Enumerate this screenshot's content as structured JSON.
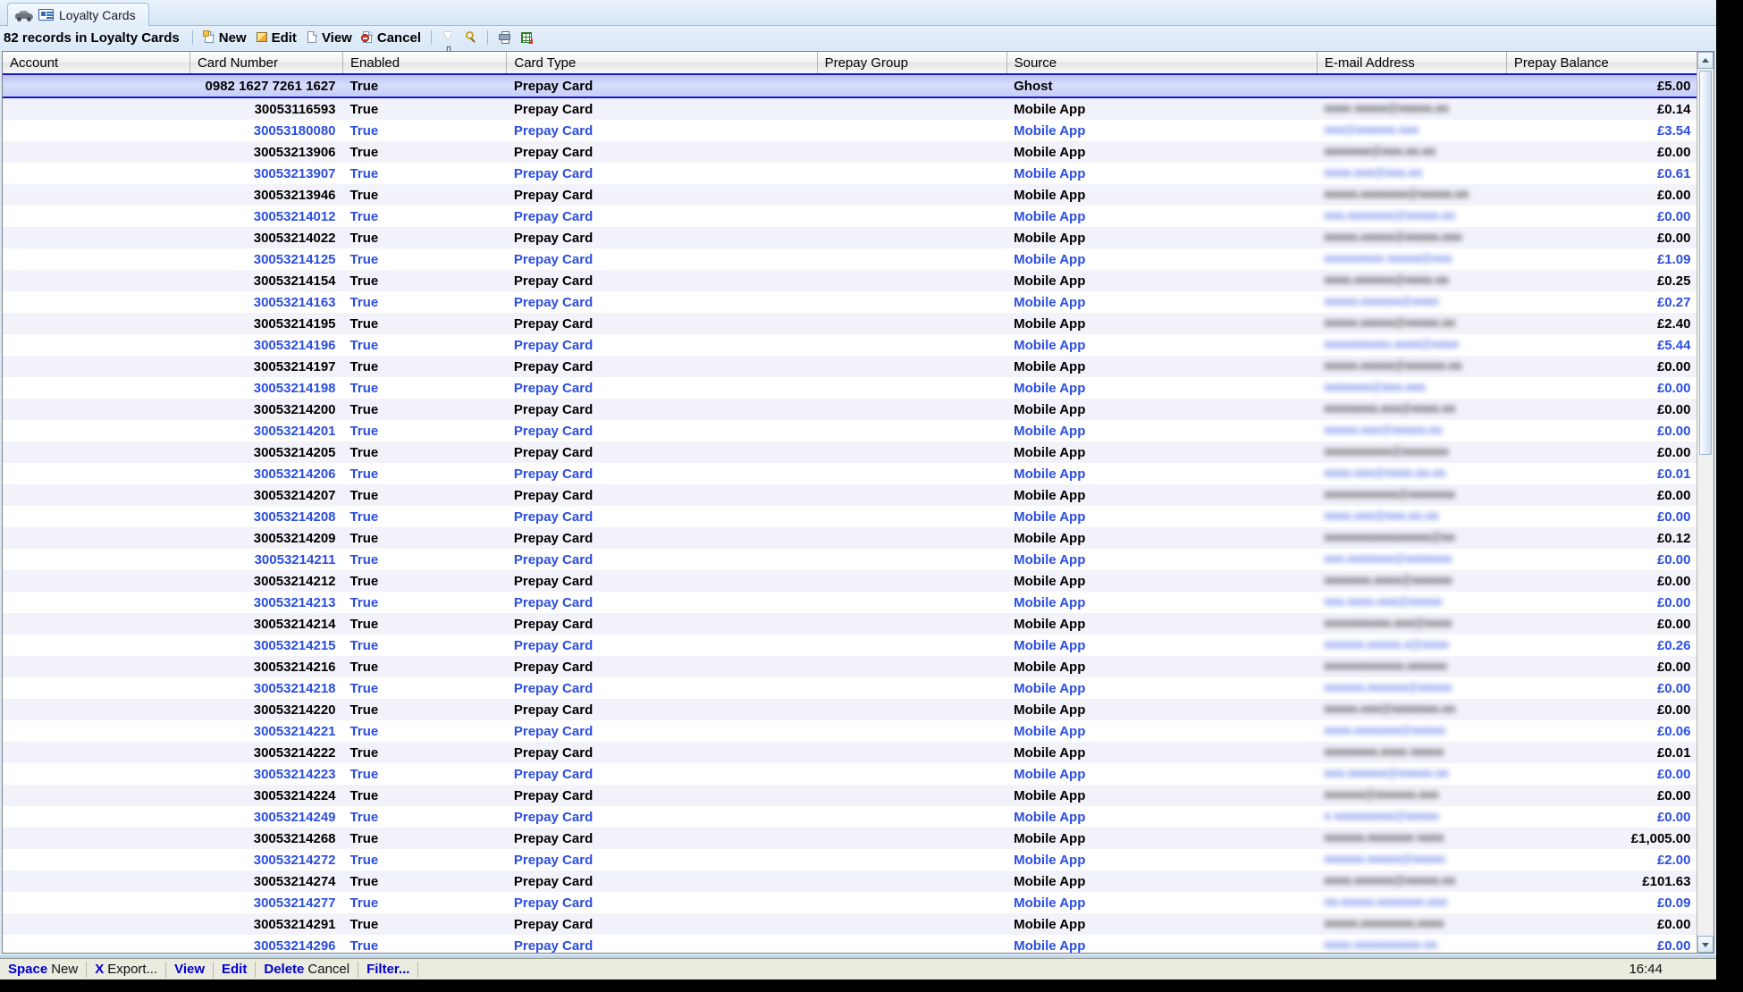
{
  "window": {
    "tab": {
      "title": "Loyalty Cards",
      "car_icon": "car-icon",
      "card_icon": "card-icon"
    }
  },
  "toolbar": {
    "record_count": "82 records in Loyalty Cards",
    "new_label": "New",
    "edit_label": "Edit",
    "view_label": "View",
    "cancel_label": "Cancel",
    "icons": [
      "new-page-icon",
      "pencil-icon",
      "page-icon",
      "cancel-icon",
      "filter-funnel-icon",
      "magnifier-icon",
      "printer-icon",
      "export-grid-icon"
    ]
  },
  "grid": {
    "columns": [
      "Account",
      "Card Number",
      "Enabled",
      "Card Type",
      "Prepay Group",
      "Source",
      "E-mail Address",
      "Prepay Balance"
    ],
    "rows": [
      {
        "account": "",
        "number": "0982 1627 7261 1627",
        "enabled": "True",
        "type": "Prepay Card",
        "group": "",
        "source": "Ghost",
        "email": "",
        "balance": "£5.00",
        "selected": true
      },
      {
        "account": "",
        "number": "30053116593",
        "enabled": "True",
        "type": "Prepay Card",
        "group": "",
        "source": "Mobile App",
        "email": "aaaa aaaaa@aaaaa.aa",
        "balance": "£0.14"
      },
      {
        "account": "",
        "number": "30053180080",
        "enabled": "True",
        "type": "Prepay Card",
        "group": "",
        "source": "Mobile App",
        "email": "aaa@aaaaaa.aaa",
        "balance": "£3.54"
      },
      {
        "account": "",
        "number": "30053213906",
        "enabled": "True",
        "type": "Prepay Card",
        "group": "",
        "source": "Mobile App",
        "email": "aaaaaaa@aaa.aa.aa",
        "balance": "£0.00"
      },
      {
        "account": "",
        "number": "30053213907",
        "enabled": "True",
        "type": "Prepay Card",
        "group": "",
        "source": "Mobile App",
        "email": "aaaa.aaa@aaa.aa",
        "balance": "£0.61"
      },
      {
        "account": "",
        "number": "30053213946",
        "enabled": "True",
        "type": "Prepay Card",
        "group": "",
        "source": "Mobile App",
        "email": "aaaaa.aaaaaaa@aaaaa.aa",
        "balance": "£0.00"
      },
      {
        "account": "",
        "number": "30053214012",
        "enabled": "True",
        "type": "Prepay Card",
        "group": "",
        "source": "Mobile App",
        "email": "aaa.aaaaaaa@aaaaa.aa",
        "balance": "£0.00"
      },
      {
        "account": "",
        "number": "30053214022",
        "enabled": "True",
        "type": "Prepay Card",
        "group": "",
        "source": "Mobile App",
        "email": "aaaaa.aaaaa@aaaaa.aaa",
        "balance": "£0.00"
      },
      {
        "account": "",
        "number": "30053214125",
        "enabled": "True",
        "type": "Prepay Card",
        "group": "",
        "source": "Mobile App",
        "email": "aaaaaaaaa aaaaa@aaa",
        "balance": "£1.09"
      },
      {
        "account": "",
        "number": "30053214154",
        "enabled": "True",
        "type": "Prepay Card",
        "group": "",
        "source": "Mobile App",
        "email": "aaaa.aaaaaa@aaaa.aa",
        "balance": "£0.25"
      },
      {
        "account": "",
        "number": "30053214163",
        "enabled": "True",
        "type": "Prepay Card",
        "group": "",
        "source": "Mobile App",
        "email": "aaaaa.aaaaaa@aaaa",
        "balance": "£0.27"
      },
      {
        "account": "",
        "number": "30053214195",
        "enabled": "True",
        "type": "Prepay Card",
        "group": "",
        "source": "Mobile App",
        "email": "aaaaa.aaaaa@aaaaa.aa",
        "balance": "£2.40"
      },
      {
        "account": "",
        "number": "30053214196",
        "enabled": "True",
        "type": "Prepay Card",
        "group": "",
        "source": "Mobile App",
        "email": "aaaaaaaaaa.aaaa@aaaa",
        "balance": "£5.44"
      },
      {
        "account": "",
        "number": "30053214197",
        "enabled": "True",
        "type": "Prepay Card",
        "group": "",
        "source": "Mobile App",
        "email": "aaaaa.aaaaa@aaaaaa.aa",
        "balance": "£0.00"
      },
      {
        "account": "",
        "number": "30053214198",
        "enabled": "True",
        "type": "Prepay Card",
        "group": "",
        "source": "Mobile App",
        "email": "aaaaaaa@aaa.aaa",
        "balance": "£0.00"
      },
      {
        "account": "",
        "number": "30053214200",
        "enabled": "True",
        "type": "Prepay Card",
        "group": "",
        "source": "Mobile App",
        "email": "aaaaaaaa.aaa@aaaa.aa",
        "balance": "£0.00"
      },
      {
        "account": "",
        "number": "30053214201",
        "enabled": "True",
        "type": "Prepay Card",
        "group": "",
        "source": "Mobile App",
        "email": "aaaaa.aaa@aaaaa.aa",
        "balance": "£0.00"
      },
      {
        "account": "",
        "number": "30053214205",
        "enabled": "True",
        "type": "Prepay Card",
        "group": "",
        "source": "Mobile App",
        "email": "aaaaaaaaaa@aaaaaaa",
        "balance": "£0.00"
      },
      {
        "account": "",
        "number": "30053214206",
        "enabled": "True",
        "type": "Prepay Card",
        "group": "",
        "source": "Mobile App",
        "email": "aaaa.aaa@aaaa.aa.aa",
        "balance": "£0.01"
      },
      {
        "account": "",
        "number": "30053214207",
        "enabled": "True",
        "type": "Prepay Card",
        "group": "",
        "source": "Mobile App",
        "email": "aaaaaaaaaaa@aaaaaaa",
        "balance": "£0.00"
      },
      {
        "account": "",
        "number": "30053214208",
        "enabled": "True",
        "type": "Prepay Card",
        "group": "",
        "source": "Mobile App",
        "email": "aaaa.aaa@aaa.aa.aa",
        "balance": "£0.00"
      },
      {
        "account": "",
        "number": "30053214209",
        "enabled": "True",
        "type": "Prepay Card",
        "group": "",
        "source": "Mobile App",
        "email": "aaaaaaaaaaaaaaaa@aa",
        "balance": "£0.12"
      },
      {
        "account": "",
        "number": "30053214211",
        "enabled": "True",
        "type": "Prepay Card",
        "group": "",
        "source": "Mobile App",
        "email": "aaa.aaaaaaa@aaaaaaa",
        "balance": "£0.00"
      },
      {
        "account": "",
        "number": "30053214212",
        "enabled": "True",
        "type": "Prepay Card",
        "group": "",
        "source": "Mobile App",
        "email": "aaaaaaa.aaaa@aaaaaa",
        "balance": "£0.00"
      },
      {
        "account": "",
        "number": "30053214213",
        "enabled": "True",
        "type": "Prepay Card",
        "group": "",
        "source": "Mobile App",
        "email": "aaa.aaaa.aaa@aaaaa",
        "balance": "£0.00"
      },
      {
        "account": "",
        "number": "30053214214",
        "enabled": "True",
        "type": "Prepay Card",
        "group": "",
        "source": "Mobile App",
        "email": "aaaaaaaaaa.aaa@aaaa",
        "balance": "£0.00"
      },
      {
        "account": "",
        "number": "30053214215",
        "enabled": "True",
        "type": "Prepay Card",
        "group": "",
        "source": "Mobile App",
        "email": "aaaaaa.aaaaa.a@aaaa",
        "balance": "£0.26"
      },
      {
        "account": "",
        "number": "30053214216",
        "enabled": "True",
        "type": "Prepay Card",
        "group": "",
        "source": "Mobile App",
        "email": "aaaaaaaaaaaa.aaaaaa",
        "balance": "£0.00"
      },
      {
        "account": "",
        "number": "30053214218",
        "enabled": "True",
        "type": "Prepay Card",
        "group": "",
        "source": "Mobile App",
        "email": "aaaaaa.aaaaaa@aaaaa",
        "balance": "£0.00"
      },
      {
        "account": "",
        "number": "30053214220",
        "enabled": "True",
        "type": "Prepay Card",
        "group": "",
        "source": "Mobile App",
        "email": "aaaaa.aaa@aaaaaaa.aa",
        "balance": "£0.00"
      },
      {
        "account": "",
        "number": "30053214221",
        "enabled": "True",
        "type": "Prepay Card",
        "group": "",
        "source": "Mobile App",
        "email": "aaaa.aaaaaaa@aaaaa",
        "balance": "£0.06"
      },
      {
        "account": "",
        "number": "30053214222",
        "enabled": "True",
        "type": "Prepay Card",
        "group": "",
        "source": "Mobile App",
        "email": "aaaaaaaa.aaaa aaaaa",
        "balance": "£0.01"
      },
      {
        "account": "",
        "number": "30053214223",
        "enabled": "True",
        "type": "Prepay Card",
        "group": "",
        "source": "Mobile App",
        "email": "aaa.aaaaaa@aaaaa.aa",
        "balance": "£0.00"
      },
      {
        "account": "",
        "number": "30053214224",
        "enabled": "True",
        "type": "Prepay Card",
        "group": "",
        "source": "Mobile App",
        "email": "aaaaaa@aaaaaa.aaa",
        "balance": "£0.00"
      },
      {
        "account": "",
        "number": "30053214249",
        "enabled": "True",
        "type": "Prepay Card",
        "group": "",
        "source": "Mobile App",
        "email": "a aaaaaaaaa@aaaaa",
        "balance": "£0.00"
      },
      {
        "account": "",
        "number": "30053214268",
        "enabled": "True",
        "type": "Prepay Card",
        "group": "",
        "source": "Mobile App",
        "email": "aaaaaa.aaaaaaa aaaa",
        "balance": "£1,005.00"
      },
      {
        "account": "",
        "number": "30053214272",
        "enabled": "True",
        "type": "Prepay Card",
        "group": "",
        "source": "Mobile App",
        "email": "aaaaaa.aaaaa@aaaaa",
        "balance": "£2.00"
      },
      {
        "account": "",
        "number": "30053214274",
        "enabled": "True",
        "type": "Prepay Card",
        "group": "",
        "source": "Mobile App",
        "email": "aaaa.aaaaaa@aaaaa.aa",
        "balance": "£101.63"
      },
      {
        "account": "",
        "number": "30053214277",
        "enabled": "True",
        "type": "Prepay Card",
        "group": "",
        "source": "Mobile App",
        "email": "aa.aaaaa.aaaaaaa.aaa",
        "balance": "£0.09"
      },
      {
        "account": "",
        "number": "30053214291",
        "enabled": "True",
        "type": "Prepay Card",
        "group": "",
        "source": "Mobile App",
        "email": "aaaaa.aaaaaaaa.aaaa",
        "balance": "£0.00"
      },
      {
        "account": "",
        "number": "30053214296",
        "enabled": "True",
        "type": "Prepay Card",
        "group": "",
        "source": "Mobile App",
        "email": "aaaa.aaaaaaaaaa.aa",
        "balance": "£0.00"
      }
    ]
  },
  "statusbar": {
    "items": [
      {
        "key": "Space",
        "label": "New"
      },
      {
        "key": "X",
        "label": "Export..."
      },
      {
        "key": "View",
        "label": ""
      },
      {
        "key": "Edit",
        "label": ""
      },
      {
        "key": "Delete",
        "label": "Cancel"
      },
      {
        "key": "Filter...",
        "label": ""
      }
    ],
    "time": "16:44"
  },
  "colors": {
    "accent_blue": "#2b4ee0",
    "row_alt": "#f2f2fb",
    "selected_border": "#1818c8",
    "status_bg": "#ecebe0",
    "header_bg": "#e4e4e4"
  }
}
